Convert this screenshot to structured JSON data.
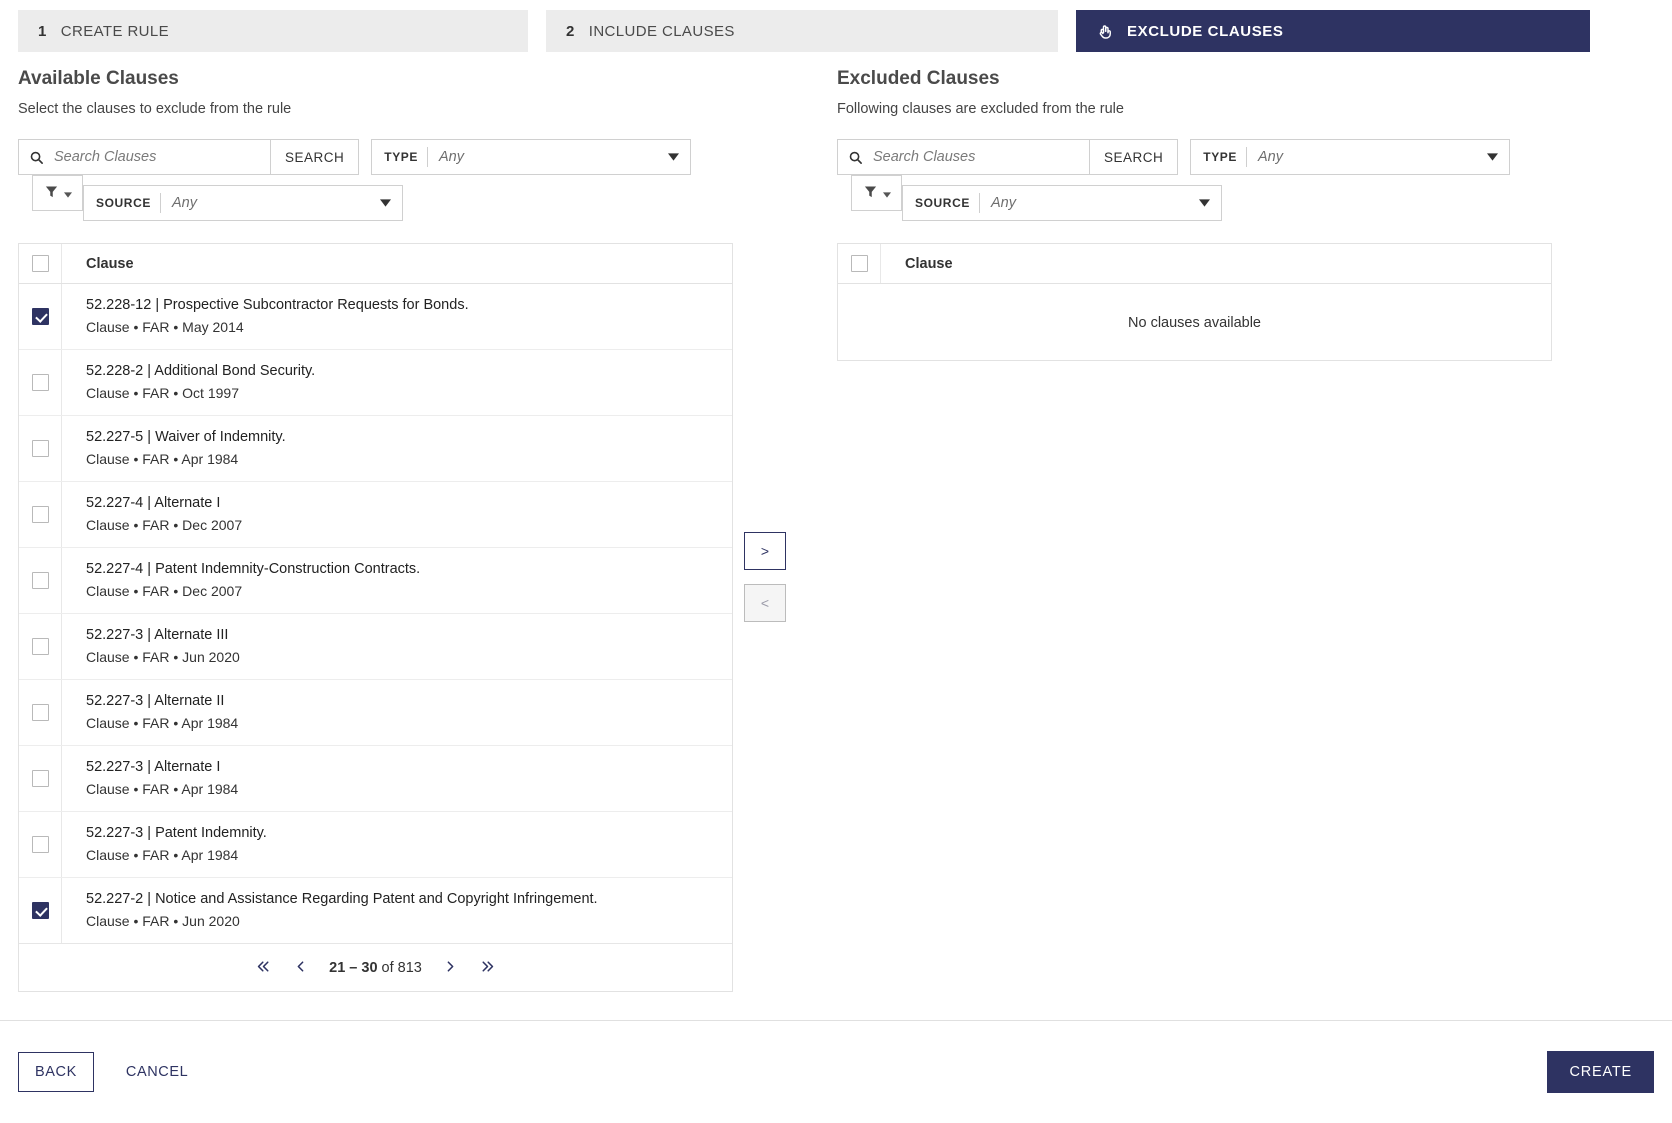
{
  "stepper": {
    "steps": [
      {
        "num": "1",
        "label": "CREATE RULE",
        "icon": "",
        "active": false
      },
      {
        "num": "2",
        "label": "INCLUDE CLAUSES",
        "icon": "",
        "active": false
      },
      {
        "num": "",
        "label": "EXCLUDE CLAUSES",
        "icon": "hand-pointer-icon",
        "active": true
      }
    ]
  },
  "available": {
    "title": "Available Clauses",
    "subtitle": "Select the clauses to exclude from the rule",
    "search": {
      "placeholder": "Search Clauses",
      "value": "",
      "button": "SEARCH",
      "icon": "search-icon"
    },
    "type_filter": {
      "label": "TYPE",
      "value": "Any"
    },
    "source_filter": {
      "label": "SOURCE",
      "value": "Any"
    },
    "filter_button_icon": "funnel-icon",
    "column_header": "Clause",
    "rows": [
      {
        "title": "52.228-12 | Prospective Subcontractor Requests for Bonds.",
        "meta": "Clause • FAR • May 2014",
        "checked": true
      },
      {
        "title": "52.228-2 | Additional Bond Security.",
        "meta": "Clause • FAR • Oct 1997",
        "checked": false
      },
      {
        "title": "52.227-5 | Waiver of Indemnity.",
        "meta": "Clause • FAR • Apr 1984",
        "checked": false
      },
      {
        "title": "52.227-4 | Alternate I",
        "meta": "Clause • FAR • Dec 2007",
        "checked": false
      },
      {
        "title": "52.227-4 | Patent Indemnity-Construction Contracts.",
        "meta": "Clause • FAR • Dec 2007",
        "checked": false
      },
      {
        "title": "52.227-3 | Alternate III",
        "meta": "Clause • FAR • Jun 2020",
        "checked": false
      },
      {
        "title": "52.227-3 | Alternate II",
        "meta": "Clause • FAR • Apr 1984",
        "checked": false
      },
      {
        "title": "52.227-3 | Alternate I",
        "meta": "Clause • FAR • Apr 1984",
        "checked": false
      },
      {
        "title": "52.227-3 | Patent Indemnity.",
        "meta": "Clause • FAR • Apr 1984",
        "checked": false
      },
      {
        "title": "52.227-2 | Notice and Assistance Regarding Patent and Copyright Infringement.",
        "meta": "Clause • FAR • Jun 2020",
        "checked": true
      }
    ],
    "pagination": {
      "range": "21 – 30",
      "of": "of 813",
      "first_icon": "double-chevron-left-icon",
      "prev_icon": "chevron-left-icon",
      "next_icon": "chevron-right-icon",
      "last_icon": "double-chevron-right-icon"
    }
  },
  "excluded": {
    "title": "Excluded Clauses",
    "subtitle": "Following clauses are excluded from the rule",
    "search": {
      "placeholder": "Search Clauses",
      "value": "",
      "button": "SEARCH",
      "icon": "search-icon"
    },
    "type_filter": {
      "label": "TYPE",
      "value": "Any"
    },
    "source_filter": {
      "label": "SOURCE",
      "value": "Any"
    },
    "filter_button_icon": "funnel-icon",
    "column_header": "Clause",
    "empty_message": "No clauses available"
  },
  "transfer": {
    "add_label": ">",
    "remove_label": "<"
  },
  "footer": {
    "back": "BACK",
    "cancel": "CANCEL",
    "create": "CREATE"
  },
  "colors": {
    "accent": "#2e3362",
    "tab_inactive_bg": "#ececec",
    "border": "#e2e2e2"
  }
}
